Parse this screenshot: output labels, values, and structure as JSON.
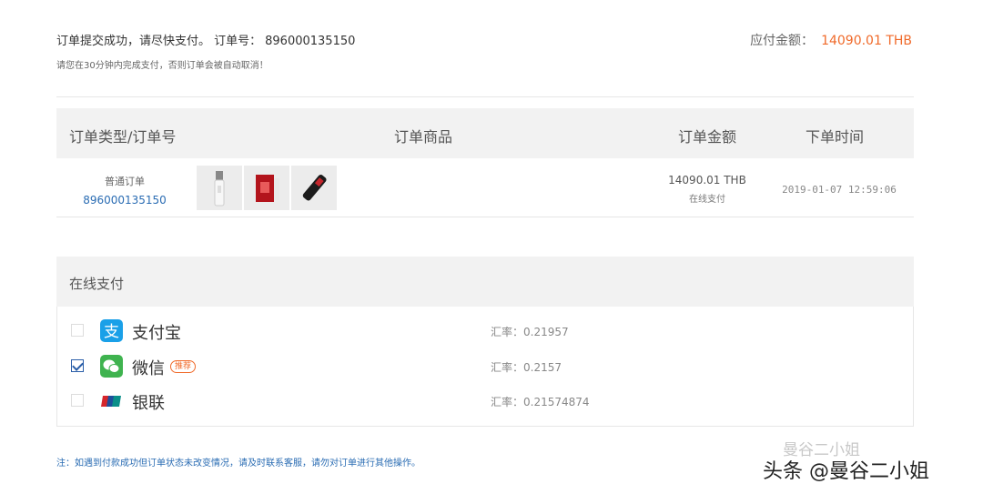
{
  "header": {
    "submit_text": "订单提交成功，请尽快支付。 订单号：",
    "order_number": "896000135150",
    "notice": "请您在30分钟内完成支付，否则订单会被自动取消！",
    "amount_label": "应付金额：",
    "amount_value": "14090.01 THB"
  },
  "order_table": {
    "columns": [
      "订单类型/订单号",
      "订单商品",
      "订单金额",
      "下单时间"
    ],
    "row": {
      "type": "普通订单",
      "number": "896000135150",
      "amount": "14090.01 THB",
      "pay_mode": "在线支付",
      "time": "2019-01-07 12:59:06"
    }
  },
  "payment": {
    "section_title": "在线支付",
    "options": [
      {
        "name": "支付宝",
        "rate": "汇率：0.21957",
        "checked": false,
        "icon": "alipay-icon",
        "color": "#1aa0e8"
      },
      {
        "name": "微信",
        "badge": "推荐",
        "rate": "汇率：0.2157",
        "checked": true,
        "icon": "wechat-icon",
        "color": "#3fb34f"
      },
      {
        "name": "银联",
        "rate": "汇率：0.21574874",
        "checked": false,
        "icon": "unionpay-icon",
        "color": "#d6262c"
      }
    ]
  },
  "footer_note": "注：如遇到付款成功但订单状态未改变情况，请及时联系客服，请勿对订单进行其他操作。",
  "watermark": {
    "line1": "曼谷二小姐",
    "line2": "头条 @曼谷二小姐"
  },
  "colors": {
    "accent": "#f06a2a",
    "link": "#2a6cb3"
  }
}
